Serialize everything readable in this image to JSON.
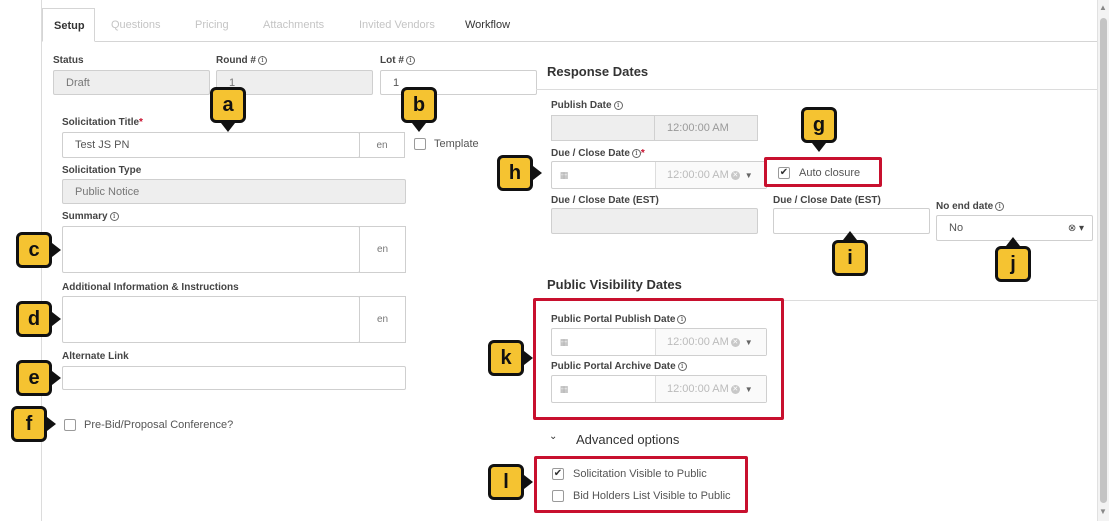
{
  "tabs": [
    {
      "label": "Setup",
      "state": "active"
    },
    {
      "label": "Questions",
      "state": "disabled"
    },
    {
      "label": "Pricing",
      "state": "disabled"
    },
    {
      "label": "Attachments",
      "state": "disabled"
    },
    {
      "label": "Invited Vendors",
      "state": "disabled"
    },
    {
      "label": "Workflow",
      "state": "enabled"
    }
  ],
  "setup": {
    "status_label": "Status",
    "status_value": "Draft",
    "round_label": "Round #",
    "round_value": "1",
    "lot_label": "Lot #",
    "lot_value": "1",
    "title_label": "Solicitation Title",
    "title_value": "Test JS PN",
    "lang": "en",
    "template_label": "Template",
    "type_label": "Solicitation Type",
    "type_value": "Public Notice",
    "summary_label": "Summary",
    "additional_label": "Additional Information & Instructions",
    "alternate_label": "Alternate Link",
    "prebid_label": "Pre-Bid/Proposal Conference?",
    "required_mark": "*",
    "info_glyph": "i"
  },
  "response_dates": {
    "title": "Response Dates",
    "publish_label": "Publish Date",
    "publish_time": "12:00:00 AM",
    "due_label": "Due / Close Date",
    "due_time": "12:00:00 AM",
    "auto_closure_label": "Auto closure",
    "auto_closure_checked": true,
    "due_est_label": "Due / Close Date (EST)",
    "due_est_label_2": "Due / Close Date (EST)",
    "no_end_label": "No end date",
    "no_end_value": "No"
  },
  "visibility": {
    "title": "Public Visibility Dates",
    "portal_publish_label": "Public Portal Publish Date",
    "portal_publish_time": "12:00:00 AM",
    "portal_archive_label": "Public Portal Archive Date",
    "portal_archive_time": "12:00:00 AM"
  },
  "advanced": {
    "title": "Advanced options",
    "solicitation_visible_label": "Solicitation Visible to Public",
    "solicitation_visible_checked": true,
    "bid_holders_label": "Bid Holders List Visible to Public",
    "bid_holders_checked": false
  },
  "callouts": {
    "a": "a",
    "b": "b",
    "c": "c",
    "d": "d",
    "e": "e",
    "f": "f",
    "g": "g",
    "h": "h",
    "i": "i",
    "j": "j",
    "k": "k",
    "l": "l",
    "color": "#f5c331",
    "highlight_color": "#c8102e"
  },
  "icons": {
    "calendar": "calendar-icon",
    "clear": "clear-icon",
    "caret": "chevron-down-icon",
    "check": "check-icon"
  }
}
